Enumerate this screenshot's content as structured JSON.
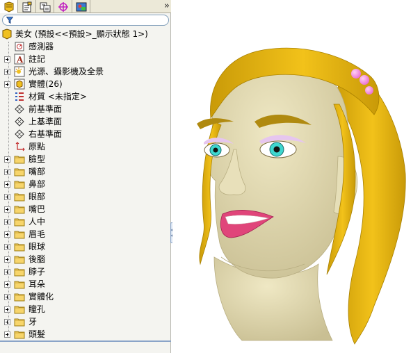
{
  "tabs": [
    {
      "name": "feature-manager",
      "icon": "feature-tree-icon",
      "active": true
    },
    {
      "name": "property-manager",
      "icon": "property-manager-icon",
      "active": false
    },
    {
      "name": "configuration-manager",
      "icon": "configuration-icon",
      "active": false
    },
    {
      "name": "dimxpert",
      "icon": "crosshair-icon",
      "active": false
    },
    {
      "name": "display-manager",
      "icon": "display-manager-icon",
      "active": false
    }
  ],
  "more_tabs": "»",
  "filter_icon": "filter-icon",
  "tree": {
    "root": "美女 (預設<<預設>_顯示狀態 1>)",
    "items": [
      {
        "label": "感測器",
        "icon": "sensor-icon",
        "expandable": false
      },
      {
        "label": "註記",
        "icon": "annotation-icon",
        "expandable": true
      },
      {
        "label": "光源、攝影機及全景",
        "icon": "lights-icon",
        "expandable": true
      },
      {
        "label": "實體(26)",
        "icon": "solid-bodies-icon",
        "expandable": true
      },
      {
        "label": "材質 <未指定>",
        "icon": "material-icon",
        "expandable": false
      },
      {
        "label": "前基準面",
        "icon": "plane-icon",
        "expandable": false
      },
      {
        "label": "上基準面",
        "icon": "plane-icon",
        "expandable": false
      },
      {
        "label": "右基準面",
        "icon": "plane-icon",
        "expandable": false
      },
      {
        "label": "原點",
        "icon": "origin-icon",
        "expandable": false
      },
      {
        "label": "臉型",
        "icon": "folder-icon",
        "expandable": true
      },
      {
        "label": "嘴部",
        "icon": "folder-icon",
        "expandable": true
      },
      {
        "label": "鼻部",
        "icon": "folder-icon",
        "expandable": true
      },
      {
        "label": "眼部",
        "icon": "folder-icon",
        "expandable": true
      },
      {
        "label": "嘴巴",
        "icon": "folder-icon",
        "expandable": true
      },
      {
        "label": "人中",
        "icon": "folder-icon",
        "expandable": true
      },
      {
        "label": "眉毛",
        "icon": "folder-icon",
        "expandable": true
      },
      {
        "label": "眼球",
        "icon": "folder-icon",
        "expandable": true
      },
      {
        "label": "後腦",
        "icon": "folder-icon",
        "expandable": true
      },
      {
        "label": "脖子",
        "icon": "folder-icon",
        "expandable": true
      },
      {
        "label": "耳朵",
        "icon": "folder-icon",
        "expandable": true
      },
      {
        "label": "實體化",
        "icon": "folder-icon",
        "expandable": true
      },
      {
        "label": "瞳孔",
        "icon": "folder-icon",
        "expandable": true
      },
      {
        "label": "牙",
        "icon": "folder-icon",
        "expandable": true
      },
      {
        "label": "頭髮",
        "icon": "folder-icon",
        "expandable": true
      }
    ]
  },
  "colors": {
    "hair": "#f2c21a",
    "hair_dark": "#c99a08",
    "skin": "#efe8c4",
    "skin_shadow": "#c9bf93",
    "iris": "#3ed6cf",
    "lips": "#e0457a",
    "eyeshadow": "#e6c6ef",
    "beads": "#ea6fd2"
  }
}
